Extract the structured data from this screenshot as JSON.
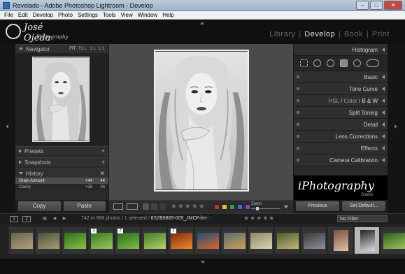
{
  "window": {
    "title": "Revelado - Adobe Photoshop Lightroom - Develop"
  },
  "menu": [
    "File",
    "Edit",
    "Develop",
    "Photo",
    "Settings",
    "Tools",
    "View",
    "Window",
    "Help"
  ],
  "identity": {
    "name": "José Ojeda",
    "sub": "Photography"
  },
  "modules": [
    {
      "label": "Library",
      "active": false
    },
    {
      "label": "Develop",
      "active": true
    },
    {
      "label": "Book",
      "active": false
    },
    {
      "label": "Print",
      "active": false
    }
  ],
  "left": {
    "navigator": {
      "title": "Navigator",
      "options": [
        "FIT",
        "FILL",
        "1:1",
        "1:3"
      ]
    },
    "presets": "Presets",
    "snapshots": "Snapshots",
    "history": {
      "title": "History",
      "rows": [
        {
          "label": "Grain Amount",
          "v1": "+44",
          "v2": "44"
        },
        {
          "label": "Clarity",
          "v1": "+28",
          "v2": "36"
        }
      ]
    },
    "buttons": {
      "copy": "Copy",
      "paste": "Paste"
    }
  },
  "right": {
    "histogram": "Histogram",
    "sections": [
      "Basic",
      "Tone Curve"
    ],
    "hsl": {
      "h": "HSL",
      "c": "Color",
      "bw": "B & W"
    },
    "sections2": [
      "Split Toning",
      "Detail",
      "Lens Corrections",
      "Effects",
      "Camera Calibration"
    ],
    "brand": {
      "text": "iPhotography",
      "sub": "Studio"
    },
    "buttons": {
      "previous": "Previous",
      "set_default": "Set Default..."
    }
  },
  "toolbar": {
    "stars": "★★★★★",
    "zoom": "Zoom",
    "zoom_level": 0.22,
    "colors": [
      "#c8322c",
      "#d6c63a",
      "#3f9b3f",
      "#3d6fc7",
      "#8a44b9"
    ]
  },
  "filmstrip": {
    "page_buttons": [
      "1",
      "2"
    ],
    "info_prefix": "742 of 968 photos /",
    "info_selected": "1 selected /",
    "info_file": "8S2B9889-009_JMO",
    "filter_label": "Filter :",
    "stars": "★★★★★",
    "filter_value": "No Filter",
    "thumbs": [
      {
        "colors": [
          "#6a6050",
          "#b3a27d"
        ],
        "portrait": false,
        "badge": "",
        "sel": false
      },
      {
        "colors": [
          "#4a4f3e",
          "#a79b72"
        ],
        "portrait": false,
        "badge": "",
        "sel": false
      },
      {
        "colors": [
          "#2f6d1c",
          "#8ac04a"
        ],
        "portrait": false,
        "badge": "",
        "sel": false
      },
      {
        "colors": [
          "#3a7a24",
          "#9ac65a"
        ],
        "portrait": false,
        "badge": "2",
        "sel": false
      },
      {
        "colors": [
          "#2b6a1e",
          "#7fbc46"
        ],
        "portrait": false,
        "badge": "2",
        "sel": false
      },
      {
        "colors": [
          "#3f7a28",
          "#b6d46a"
        ],
        "portrait": false,
        "badge": "",
        "sel": false
      },
      {
        "colors": [
          "#7a2a14",
          "#f08a2c"
        ],
        "portrait": false,
        "badge": "2",
        "sel": false
      },
      {
        "colors": [
          "#1d4e7a",
          "#d9662a"
        ],
        "portrait": false,
        "badge": "",
        "sel": false
      },
      {
        "colors": [
          "#5a6a70",
          "#c8a35a"
        ],
        "portrait": false,
        "badge": "",
        "sel": false
      },
      {
        "colors": [
          "#8a8a6a",
          "#d8d2b0"
        ],
        "portrait": false,
        "badge": "",
        "sel": false
      },
      {
        "colors": [
          "#4a5a2a",
          "#c9b77a"
        ],
        "portrait": false,
        "badge": "",
        "sel": false
      },
      {
        "colors": [
          "#3a3a3a",
          "#8a8f98"
        ],
        "portrait": false,
        "badge": "",
        "sel": false
      },
      {
        "colors": [
          "#7a5040",
          "#e0c0a8"
        ],
        "portrait": true,
        "badge": "",
        "sel": false
      },
      {
        "colors": [
          "#222222",
          "#dddddd"
        ],
        "portrait": true,
        "badge": "",
        "sel": true
      },
      {
        "colors": [
          "#2f5a1e",
          "#9ac65a"
        ],
        "portrait": false,
        "badge": "",
        "sel": false
      }
    ]
  }
}
